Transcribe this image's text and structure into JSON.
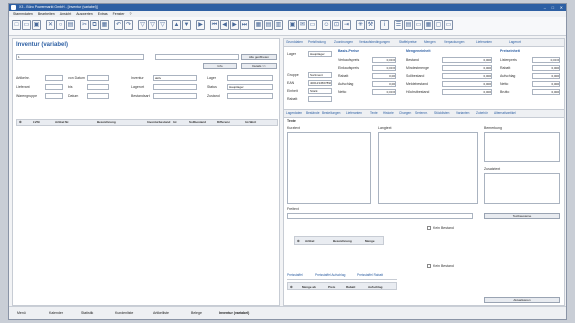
{
  "window": {
    "title": "X3 - Büro Powermarkt GmbH - [Inventur (variabel)]"
  },
  "menu": [
    "Stammdaten",
    "Bearbeiten",
    "Ansicht",
    "Auswerten",
    "Extras",
    "Fenster",
    "?"
  ],
  "left": {
    "title": "Inventur (variabel)",
    "search_value": "1",
    "btn_all": "Alle geöffneten",
    "btn_info": "Info",
    "btn_details": "Details >>",
    "filter": {
      "artikelnr": "Artikelnr.",
      "datum_von": "von Datum",
      "inventur": "Inventur",
      "inventur_value": "aktiv",
      "lager": "Lager",
      "lieferant": "Lieferant",
      "bis": "bis",
      "lagerort": "Lagerort",
      "lagerort_value": "Hauptlager",
      "warengruppe": "Warengruppe",
      "status": "Status",
      "datum": "Datum",
      "bestandsart": "Bestandsart",
      "zustand": "Zustand"
    },
    "columns": [
      "LVNr",
      "Artikel Nr.",
      "Bezeichnung",
      "Inventurbestand",
      "Ist",
      "Sollbestand",
      "Differenz",
      "Ist-Wert"
    ]
  },
  "right": {
    "tabs": [
      "Grunddaten",
      "Preisfindung",
      "Zuordnungen",
      "Verkaufsbedingungen",
      "Staffelpreise",
      "Mengen",
      "Verpackungen",
      "Lieferanten",
      "Lagerort"
    ],
    "fields": {
      "lager": "Lager",
      "gruppe": "Gruppe",
      "ean": "EAN",
      "einheit": "Einheit",
      "rabatt": "Rabatt",
      "verkaufspreis": "Verkaufspreis"
    },
    "values": {
      "lager_value": "Hauptlager",
      "gruppe_value": "Sortiment",
      "ean_value": "4001234567890",
      "einheit_value": "Stück"
    },
    "basis_header": "Basis-Preise",
    "mengen_header": "Mengeneinheit",
    "preis_header": "Preiseinheit",
    "basis_rows": [
      "Verkaufspreis",
      "Einkaufspreis",
      "Rabatt",
      "Aufschlag",
      "Netto"
    ],
    "basis_vals": [
      "0,00 €",
      "0,00 €",
      "0,00",
      "0,00",
      "0,00 €"
    ],
    "mengen_rows": [
      "Bestand",
      "Mindestmenge",
      "Sollbestand",
      "Meldebestand",
      "Höchstbestand"
    ],
    "mengen_vals": [
      "0,000",
      "0,000",
      "0,000",
      "0,000",
      "0,000"
    ],
    "preis_rows": [
      "Listenpreis",
      "Rabatt",
      "Aufschlag",
      "Netto",
      "Brutto"
    ],
    "preis_vals": [
      "0,00 €",
      "0,000",
      "0,000",
      "0,000",
      "0,000"
    ],
    "tabs2": [
      "Lagerdaten",
      "Bestände",
      "Bestellungen",
      "Lieferanten",
      "Texte",
      "Historie",
      "Chargen",
      "Seriennr.",
      "Stücklisten",
      "Varianten",
      "Zubehör",
      "Alternativartikel"
    ],
    "texte_header": "Texte",
    "kurztext": "Kurztext",
    "langtext": "Langtext",
    "bemerkung": "Bemerkung",
    "zusatztext": "Zusatztext",
    "freitext_label": "Freitext",
    "textbausteine_btn": "Textbausteine",
    "kein_bestand": "Kein Bestand",
    "col2": [
      "Artikel",
      "Bezeichnung",
      "Menge"
    ],
    "tabs3": [
      "Preisstaffel",
      "Preisstaffel Aufschlag",
      "Preisstaffel Rabatt"
    ],
    "col3": [
      "Menge ab",
      "Preis",
      "Rabatt",
      "Aufschlag"
    ],
    "aktualisieren_btn": "Aktualisieren"
  },
  "status_items": [
    "Menü",
    "Kalender",
    "Statistik",
    "Kundenliste",
    "Artikelliste",
    "Belege",
    "Inventur (variabel)"
  ]
}
